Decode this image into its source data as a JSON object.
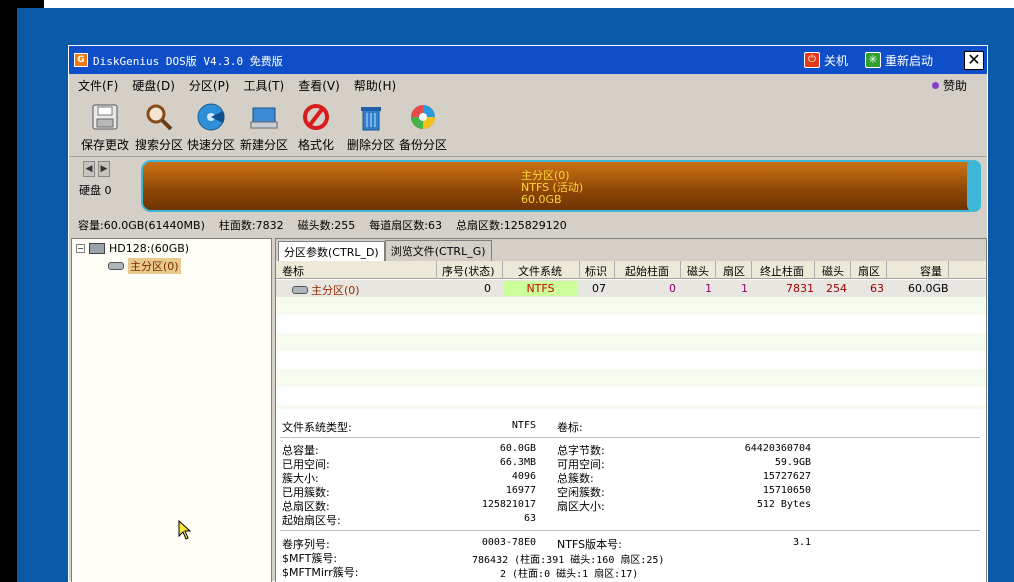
{
  "window": {
    "title": "DiskGenius DOS版 V4.3.0 免费版",
    "shutdown_label": "关机",
    "restart_label": "重新启动",
    "close_glyph": "✕"
  },
  "menu": {
    "items": [
      "文件(F)",
      "硬盘(D)",
      "分区(P)",
      "工具(T)",
      "查看(V)",
      "帮助(H)"
    ],
    "sponsor_label": "赞助"
  },
  "toolbar": {
    "tools": [
      {
        "label": "保存更改",
        "icon": "save-icon"
      },
      {
        "label": "搜索分区",
        "icon": "search-icon"
      },
      {
        "label": "快速分区",
        "icon": "quick-partition-icon"
      },
      {
        "label": "新建分区",
        "icon": "new-partition-icon"
      },
      {
        "label": "格式化",
        "icon": "format-icon"
      },
      {
        "label": "删除分区",
        "icon": "delete-icon"
      },
      {
        "label": "备份分区",
        "icon": "backup-icon"
      }
    ]
  },
  "diskmap": {
    "disk_label": "硬盘 0",
    "partition_name": "主分区(0)",
    "partition_fs": "NTFS (活动)",
    "partition_size": "60.0GB"
  },
  "diskinfo": {
    "capacity": "容量:60.0GB(61440MB)",
    "cylinders": "柱面数:7832",
    "heads": "磁头数:255",
    "sectors_per_track": "每道扇区数:63",
    "total_sectors": "总扇区数:125829120"
  },
  "tree": {
    "disk": "HD128:(60GB)",
    "partition": "主分区(0)"
  },
  "tabs": [
    "分区参数(CTRL_D)",
    "浏览文件(CTRL_G)"
  ],
  "grid": {
    "headers": [
      "卷标",
      "序号(状态)",
      "文件系统",
      "标识",
      "起始柱面",
      "磁头",
      "扇区",
      "终止柱面",
      "磁头",
      "扇区",
      "容量"
    ],
    "row": {
      "label": "主分区(0)",
      "index": "0",
      "fs": "NTFS",
      "id": "07",
      "start_cyl": "0",
      "start_head": "1",
      "start_sector": "1",
      "end_cyl": "7831",
      "end_head": "254",
      "end_sector": "63",
      "size": "60.0GB"
    },
    "colors": {
      "fs_bg": "#ccff99",
      "fs_text": "#cc0000",
      "start_text": "#990066",
      "end_text": "#990000"
    }
  },
  "details": {
    "fs_type_label": "文件系统类型:",
    "fs_type_value": "NTFS",
    "volume_label": "卷标:",
    "left": [
      {
        "label": "总容量:",
        "value": "60.0GB"
      },
      {
        "label": "已用空间:",
        "value": "66.3MB"
      },
      {
        "label": "簇大小:",
        "value": "4096"
      },
      {
        "label": "已用簇数:",
        "value": "16977"
      },
      {
        "label": "总扇区数:",
        "value": "125821017"
      },
      {
        "label": "起始扇区号:",
        "value": "63"
      }
    ],
    "right": [
      {
        "label": "总字节数:",
        "value": "64420360704"
      },
      {
        "label": "可用空间:",
        "value": "59.9GB"
      },
      {
        "label": "总簇数:",
        "value": "15727627"
      },
      {
        "label": "空闲簇数:",
        "value": "15710650"
      },
      {
        "label": "扇区大小:",
        "value": "512 Bytes"
      }
    ],
    "serial_label": "卷序列号:",
    "serial_value": "0003-78E0",
    "ntfs_version_label": "NTFS版本号:",
    "ntfs_version_value": "3.1",
    "mft_label": "$MFT簇号:",
    "mft_value": "786432 (柱面:391 磁头:160 扇区:25)",
    "mftmirr_label": "$MFTMirr簇号:",
    "mftmirr_value": "2 (柱面:0 磁头:1 扇区:17)"
  }
}
